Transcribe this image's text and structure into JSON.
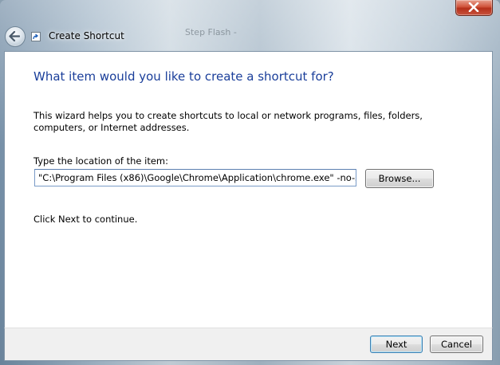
{
  "window": {
    "title": "Create Shortcut",
    "background_text": "Step Flash -"
  },
  "wizard": {
    "heading": "What item would you like to create a shortcut for?",
    "description": "This wizard helps you to create shortcuts to local or network programs, files, folders, computers, or Internet addresses.",
    "location_label": "Type the location of the item:",
    "location_value": "\"C:\\Program Files (x86)\\Google\\Chrome\\Application\\chrome.exe\" -no-sandbox",
    "browse_label": "Browse...",
    "continue_hint": "Click Next to continue."
  },
  "buttons": {
    "next_label": "Next",
    "cancel_label": "Cancel"
  },
  "icons": {
    "back": "back-arrow-icon",
    "close": "close-icon",
    "shortcut": "shortcut-icon"
  }
}
